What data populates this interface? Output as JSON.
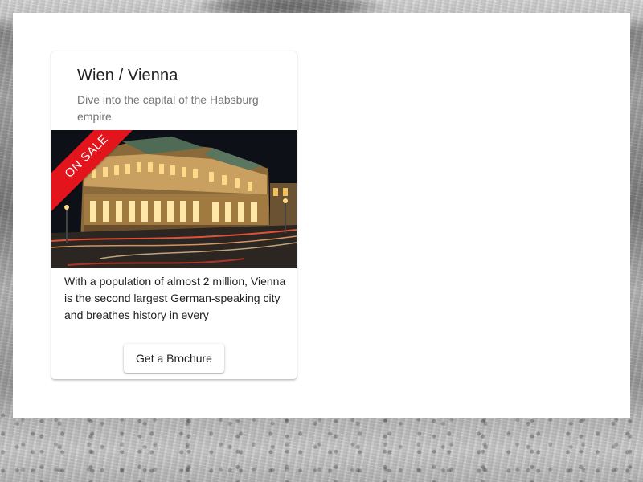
{
  "card": {
    "title": "Wien / Vienna",
    "subtitle": "Dive into the capital of the Habsburg empire",
    "image": {
      "subject": "Vienna State Opera at night",
      "ribbon_label": "ON SALE"
    },
    "description": "With a population of almost 2 million, Vienna is the second largest German-speaking city and breathes history in every",
    "action_label": "Get a Brochure"
  },
  "colors": {
    "ribbon": "#e3141b",
    "title_text": "#212121",
    "subtitle_text": "#757575",
    "card_background": "#ffffff"
  }
}
